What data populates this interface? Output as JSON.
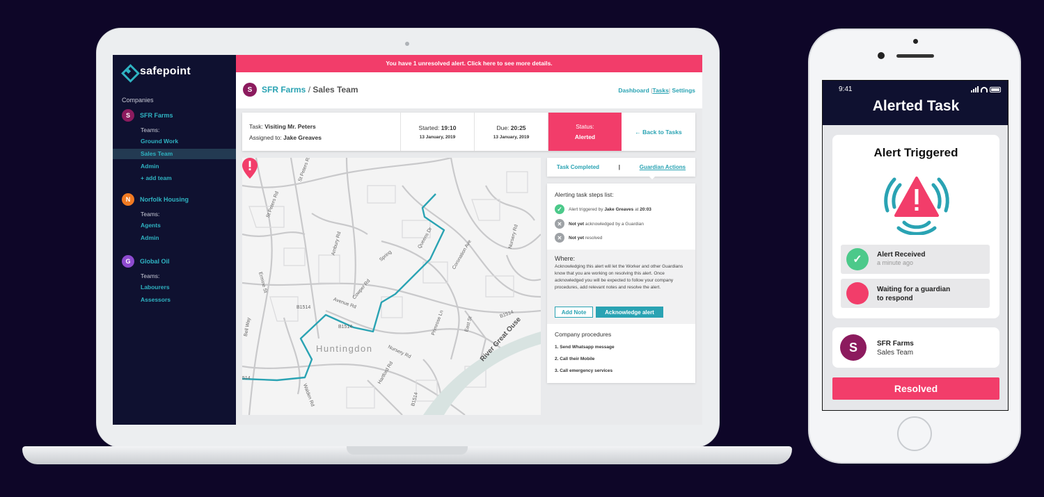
{
  "brand": {
    "name": "safepoint",
    "accent": "#2aa3b3",
    "alert": "#f23d6a",
    "dark": "#0f1130"
  },
  "sidebar": {
    "companies_label": "Companies",
    "companies": [
      {
        "initial": "S",
        "name": "SFR Farms",
        "color": "#8c1b5e",
        "teams_label": "Teams:",
        "teams": [
          "Ground Work",
          "Sales Team",
          "Admin",
          "+ add team"
        ],
        "active": "Sales Team"
      },
      {
        "initial": "N",
        "name": "Norfolk Housing",
        "color": "#f07a22",
        "teams_label": "Teams:",
        "teams": [
          "Agents",
          "Admin"
        ]
      },
      {
        "initial": "G",
        "name": "Global Oil",
        "color": "#8e4bd0",
        "teams_label": "Teams:",
        "teams": [
          "Labourers",
          "Assessors"
        ]
      }
    ]
  },
  "banner": {
    "text": "You have 1 unresolved alert. Click here to see more details."
  },
  "header": {
    "company_initial": "S",
    "company": "SFR Farms",
    "separator": " / ",
    "team": "Sales Team",
    "nav": {
      "dashboard": "Dashboard",
      "tasks": "Tasks",
      "settings": "Settings",
      "sep": "|"
    }
  },
  "task": {
    "task_label": "Task:",
    "task_name": "Visiting Mr. Peters",
    "assigned_label": "Assigned to:",
    "assigned_name": "Jake Greaves",
    "started_label": "Started:",
    "started_time": "19:10",
    "started_date": "13 January, 2019",
    "due_label": "Due:",
    "due_time": "20:25",
    "due_date": "13 January, 2019",
    "status_label": "Status:",
    "status_value": "Alerted",
    "back": "← Back to Tasks"
  },
  "map": {
    "town": "Huntingdon",
    "river": "River Great Ouse",
    "roads": [
      "St Peters Rd",
      "St Peters Rd",
      "Ermine St",
      "Bell Way",
      "B1514",
      "B1514",
      "B1514",
      "Avenue Rd",
      "Cowper Rd",
      "Spring",
      "Coronation Ave",
      "Nursery Rd",
      "Hartford Rd",
      "Walden Rd",
      "Primrose Ln",
      "Ambury Rd",
      "Queens Dr",
      "East St",
      "B1514",
      "514",
      "Nursery Rd"
    ]
  },
  "panel": {
    "tabs": {
      "completed": "Task Completed",
      "sep": "|",
      "guardian": "Guardian Actions"
    },
    "steps_title": "Alerting task steps list:",
    "steps": [
      {
        "state": "done",
        "prefix": "Alert triggered by",
        "bold": "Jake Greaves",
        "mid": "at",
        "bold2": "20:03"
      },
      {
        "state": "pending",
        "bold": "Not yet",
        "text": "acknowledged by a Guardian"
      },
      {
        "state": "pending",
        "bold": "Not yet",
        "text": "resolved"
      }
    ],
    "where_title": "Where:",
    "where_text": "Acknowledging this alert will let the Worker and other Guardians know that you are working on resolving this alert. Once acknowledged you will be expected to follow your company procedures, add relevant notes and resolve the alert.",
    "add_note": "Add Note",
    "acknowledge": "Acknowledge alert",
    "procedures_title": "Company procedures",
    "procedures": [
      "1.  Send Whatsapp message",
      "2.  Call their Mobile",
      "3.  Call emergency services"
    ]
  },
  "phone": {
    "time": "9:41",
    "title": "Alerted Task",
    "card_title": "Alert Triggered",
    "received_title": "Alert Received",
    "received_sub": "a minute ago",
    "waiting_line1": "Waiting for a guardian",
    "waiting_line2": "to respond",
    "company_initial": "S",
    "company": "SFR Farms",
    "team": "Sales Team",
    "resolved": "Resolved"
  }
}
